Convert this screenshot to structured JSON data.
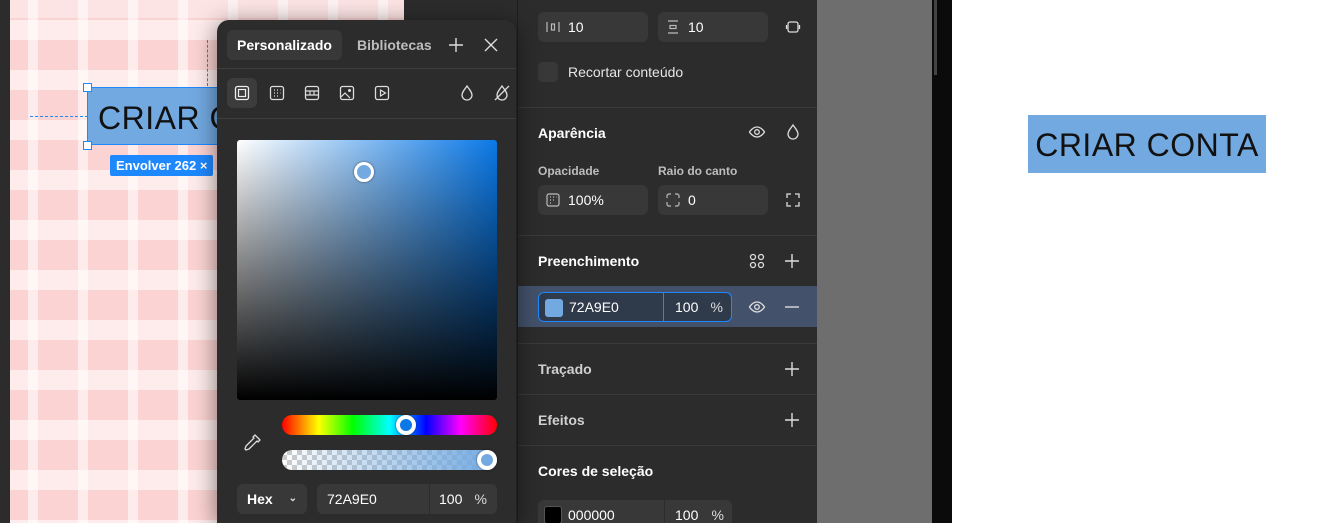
{
  "canvas": {
    "element_text": "CRIAR C",
    "size_badge": "Envolver  262 ×"
  },
  "color_picker": {
    "tab_custom": "Personalizado",
    "tab_libraries": "Bibliotecas",
    "format": "Hex",
    "hex_value": "72A9E0",
    "opacity": "100",
    "opacity_unit": "%",
    "current_color": "#72A9E0"
  },
  "panel": {
    "spacing_h": "10",
    "spacing_v": "10",
    "clip_content": "Recortar conteúdo",
    "appearance_title": "Aparência",
    "opacity_label": "Opacidade",
    "opacity_value": "100%",
    "radius_label": "Raio do canto",
    "radius_value": "0",
    "fill_title": "Preenchimento",
    "fill_hex": "72A9E0",
    "fill_opacity": "100",
    "fill_unit": "%",
    "stroke_title": "Traçado",
    "effects_title": "Efeitos",
    "selection_colors_title": "Cores de seleção",
    "sel_color_hex": "000000",
    "sel_color_opacity": "100",
    "sel_color_unit": "%"
  },
  "preview": {
    "button_text": "CRIAR CONTA"
  }
}
